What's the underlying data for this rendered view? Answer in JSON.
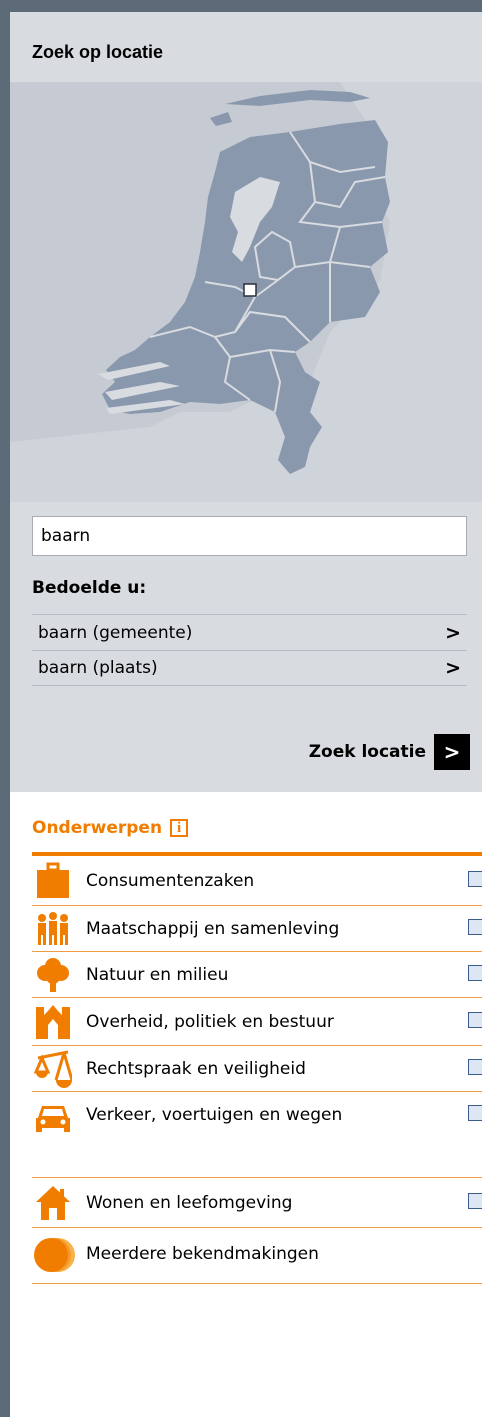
{
  "location": {
    "title": "Zoek op locatie",
    "search_value": "baarn",
    "suggest_title": "Bedoelde u:",
    "suggestions": [
      {
        "label": "baarn (gemeente)",
        "arrow": ">"
      },
      {
        "label": "baarn (plaats)",
        "arrow": ">"
      }
    ],
    "search_button_label": "Zoek locatie",
    "search_button_arrow": ">"
  },
  "topics": {
    "title": "Onderwerpen",
    "info_glyph": "i",
    "items": [
      {
        "label": "Consumentenzaken",
        "icon": "briefcase-icon"
      },
      {
        "label": "Maatschappij en samenleving",
        "icon": "people-icon"
      },
      {
        "label": "Natuur en milieu",
        "icon": "tree-icon"
      },
      {
        "label": "Overheid, politiek en bestuur",
        "icon": "government-building-icon"
      },
      {
        "label": "Rechtspraak en veiligheid",
        "icon": "scales-icon"
      },
      {
        "label": "Verkeer, voertuigen en wegen",
        "icon": "car-icon"
      },
      {
        "label": "Wonen en leefomgeving",
        "icon": "house-icon"
      },
      {
        "label": "Meerdere bekendmakingen",
        "icon": "multiple-circles-icon"
      }
    ]
  },
  "colors": {
    "accent": "#f07d00",
    "panel": "#d8dbe0",
    "map_land": "#8a98ae",
    "map_sea": "#c6cbd3"
  }
}
